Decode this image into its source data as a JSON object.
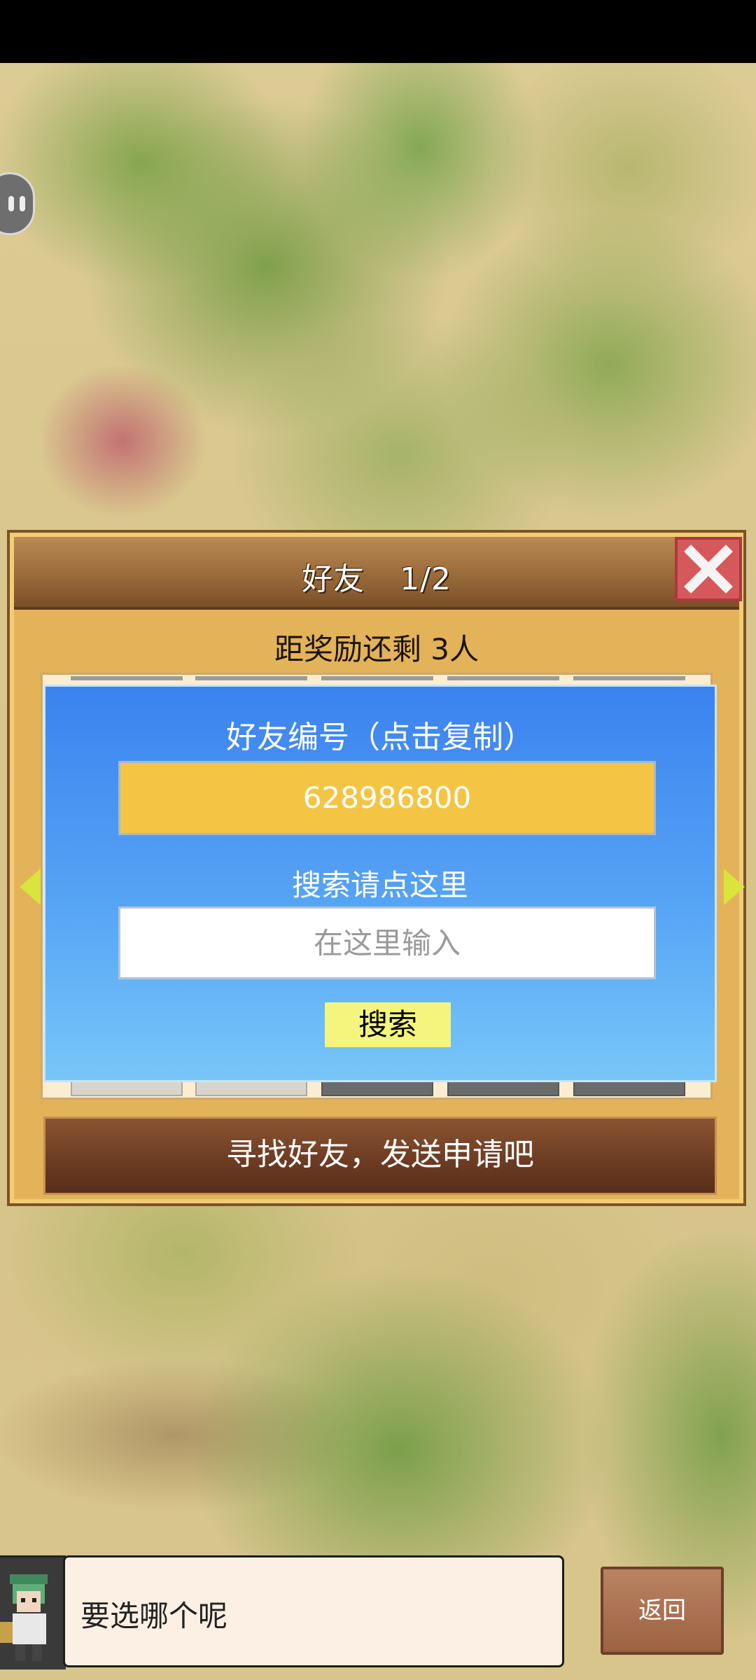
{
  "dialog": {
    "title": "好友",
    "page": "1/2",
    "reward_text": "距奖励还剩 3人",
    "friend_id_label": "好友编号（点击复制）",
    "friend_id": "628986800",
    "search_label": "搜索请点这里",
    "search_placeholder": "在这里输入",
    "search_button": "搜索",
    "find_button": "寻找好友，发送申请吧"
  },
  "speech": {
    "text": "要选哪个呢"
  },
  "back_button": "返回",
  "icons": [
    "close-icon",
    "arrow-left-icon",
    "arrow-right-icon",
    "character-avatar",
    "side-tab-icon"
  ],
  "colors": {
    "panel_blue": "#3b82ef",
    "id_box": "#f4c545",
    "search_btn": "#f5f57e",
    "close_btn": "#d7585a"
  }
}
